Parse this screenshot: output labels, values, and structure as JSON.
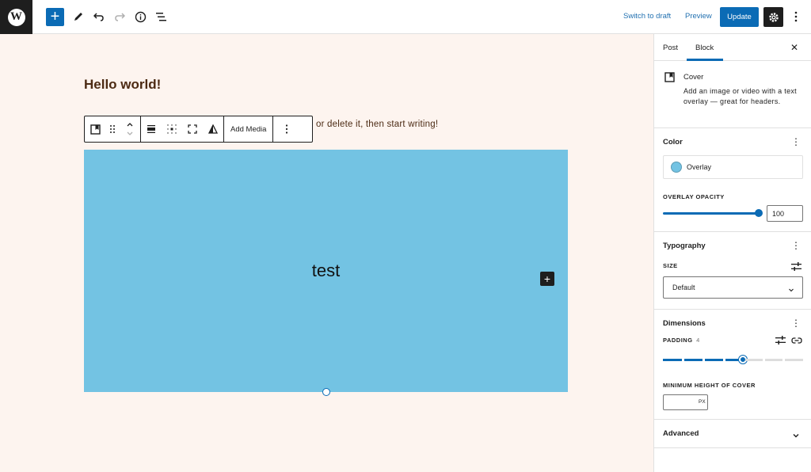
{
  "topbar": {
    "logo_glyph": "W",
    "add_label": "+",
    "switch_to_draft": "Switch to draft",
    "preview": "Preview",
    "update": "Update",
    "icons": [
      "wordpress-logo",
      "add-block-icon",
      "edit-tools-icon",
      "undo-icon",
      "redo-icon",
      "info-icon",
      "list-view-icon",
      "settings-icon",
      "options-icon"
    ]
  },
  "canvas": {
    "title": "Hello world!",
    "paragraph_visible": "or delete it, then start writing!",
    "block_toolbar": {
      "add_media": "Add Media"
    },
    "cover": {
      "text": "test",
      "overlay_color": "#73c3e3"
    }
  },
  "sidebar": {
    "tabs": [
      {
        "label": "Post",
        "active": false
      },
      {
        "label": "Block",
        "active": true
      }
    ],
    "close_glyph": "✕",
    "block_card": {
      "name": "Cover",
      "description": "Add an image or video with a text overlay — great for headers."
    },
    "color": {
      "title": "Color",
      "overlay_label": "Overlay",
      "overlay_opacity_label": "OVERLAY OPACITY",
      "overlay_opacity_value": "100"
    },
    "typography": {
      "title": "Typography",
      "size_label": "SIZE",
      "size_value": "Default"
    },
    "dimensions": {
      "title": "Dimensions",
      "padding_label": "PADDING",
      "padding_value": "4",
      "min_height_label": "MINIMUM HEIGHT OF COVER",
      "min_height_unit": "PX"
    },
    "advanced": {
      "title": "Advanced"
    }
  },
  "colors": {
    "accent": "#0b6bb5",
    "canvas_bg": "#fdf4ef",
    "heading_text": "#4c2b14",
    "cover_overlay": "#73c3e3"
  }
}
